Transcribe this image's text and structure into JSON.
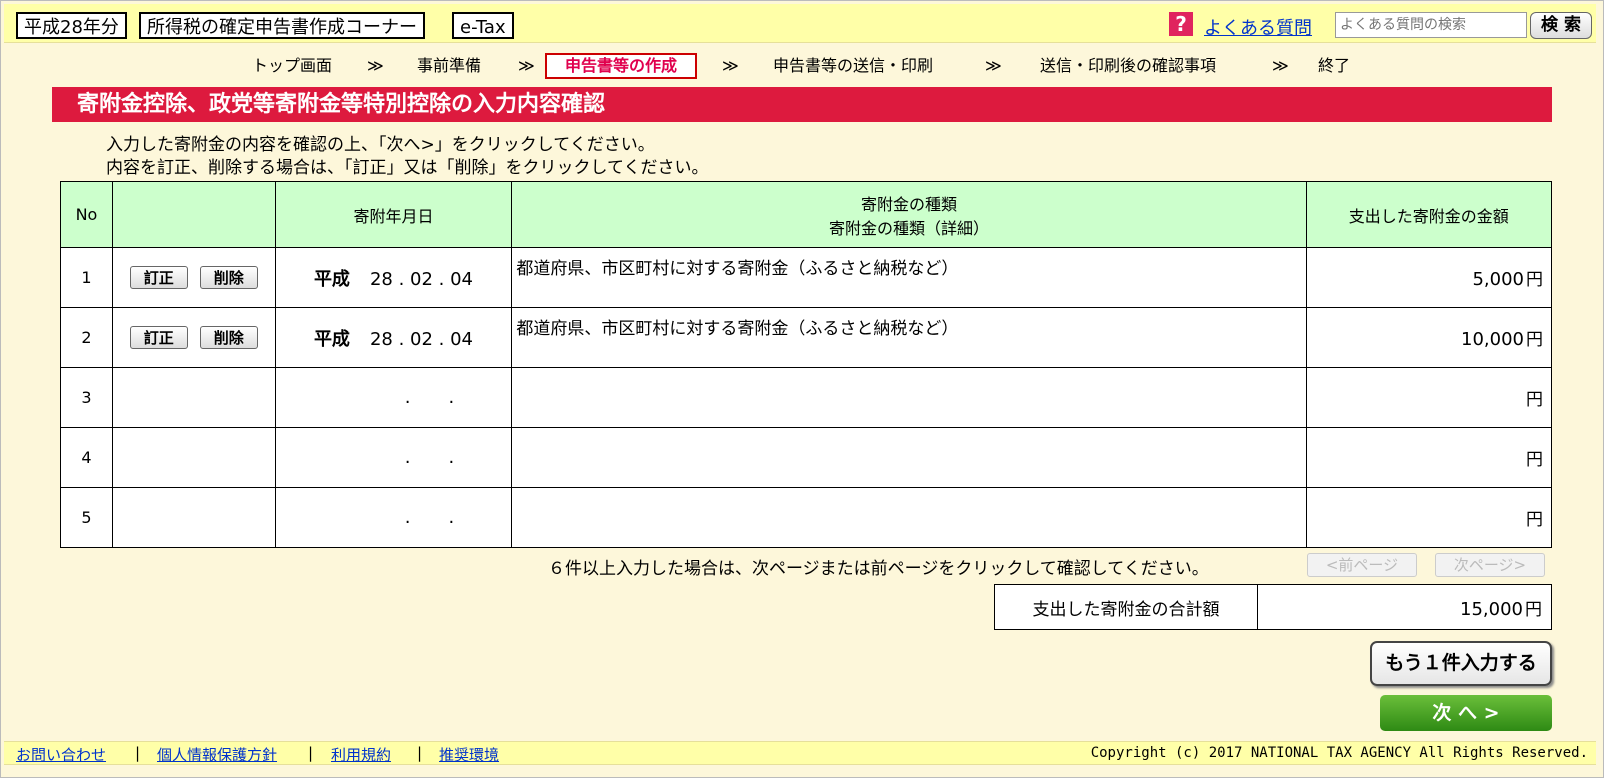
{
  "header": {
    "year_label": "平成28年分",
    "corner_title": "所得税の確定申告書作成コーナー",
    "etax_label": "e-Tax",
    "faq_icon": "question-icon",
    "faq_link": "よくある質問",
    "search_placeholder": "よくある質問の検索",
    "search_button": "検 索"
  },
  "steps": [
    {
      "label": "トップ画面"
    },
    {
      "sep": "≫"
    },
    {
      "label": "事前準備"
    },
    {
      "sep": "≫"
    },
    {
      "label": "申告書等の作成",
      "active": true
    },
    {
      "sep": "≫"
    },
    {
      "label": "申告書等の送信・印刷"
    },
    {
      "sep": "≫"
    },
    {
      "label": "送信・印刷後の確認事項"
    },
    {
      "sep": "≫"
    },
    {
      "label": "終了"
    }
  ],
  "page_title": "寄附金控除、政党等寄附金等特別控除の入力内容確認",
  "instructions": [
    "入力した寄附金の内容を確認の上、「次へ>」をクリックしてください。",
    "内容を訂正、削除する場合は、「訂正」又は「削除」をクリックしてください。"
  ],
  "table": {
    "headers": {
      "no": "No",
      "date": "寄附年月日",
      "type_line1": "寄附金の種類",
      "type_line2": "寄附金の種類（詳細）",
      "amount": "支出した寄附金の金額"
    },
    "edit_label": "訂正",
    "delete_label": "削除",
    "yen": "円",
    "date_dots": "..",
    "rows": [
      {
        "no": "1",
        "era": "平成",
        "date": "28 . 02 . 04",
        "type": "都道府県、市区町村に対する寄附金（ふるさと納税など）",
        "amount": "5,000"
      },
      {
        "no": "2",
        "era": "平成",
        "date": "28 . 02 . 04",
        "type": "都道府県、市区町村に対する寄附金（ふるさと納税など）",
        "amount": "10,000"
      },
      {
        "no": "3",
        "era": "",
        "date": "",
        "type": "",
        "amount": ""
      },
      {
        "no": "4",
        "era": "",
        "date": "",
        "type": "",
        "amount": ""
      },
      {
        "no": "5",
        "era": "",
        "date": "",
        "type": "",
        "amount": ""
      }
    ]
  },
  "pager": {
    "note": "６件以上入力した場合は、次ページまたは前ページをクリックして確認してください。",
    "prev": "<前ページ",
    "next": "次ページ>"
  },
  "total": {
    "label": "支出した寄附金の合計額",
    "value": "15,000",
    "yen": "円"
  },
  "buttons": {
    "add_more": "もう１件入力する",
    "next": "次 へ >"
  },
  "footer": {
    "links": [
      "お問い合わせ",
      "個人情報保護方針",
      "利用規約",
      "推奨環境"
    ],
    "separator": "|",
    "copyright": "Copyright (c) 2017 NATIONAL TAX AGENCY All Rights Reserved."
  },
  "colors": {
    "title_bar": "#dd1a3e",
    "header_bg": "#ffffa8",
    "table_header": "#ccffcc",
    "next_button": "#3a9a1e"
  }
}
